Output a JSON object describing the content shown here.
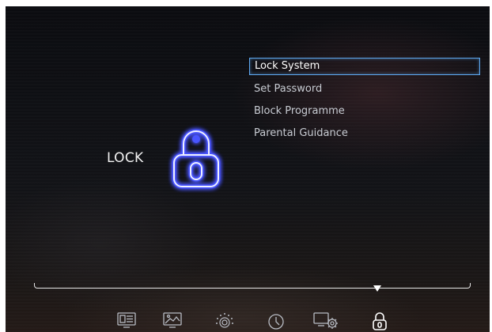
{
  "page": {
    "title": "LOCK"
  },
  "menu": {
    "items": [
      {
        "label": "Lock System",
        "selected": true
      },
      {
        "label": "Set Password",
        "selected": false
      },
      {
        "label": "Block Programme",
        "selected": false
      },
      {
        "label": "Parental Guidance",
        "selected": false
      }
    ]
  },
  "nav": {
    "icons": [
      "channel-list-icon",
      "picture-icon",
      "sound-icon",
      "clock-icon",
      "setup-icon",
      "lock-icon"
    ],
    "active": "lock-icon"
  },
  "colors": {
    "accent": "#5ea8f0",
    "glow": "#4a55ff",
    "text": "#f2f2f2"
  }
}
